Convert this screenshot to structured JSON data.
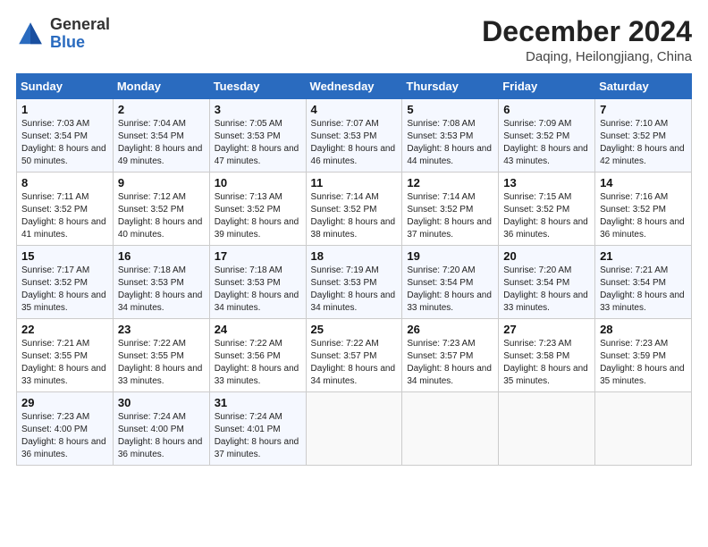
{
  "header": {
    "logo_general": "General",
    "logo_blue": "Blue",
    "month_title": "December 2024",
    "location": "Daqing, Heilongjiang, China"
  },
  "weekdays": [
    "Sunday",
    "Monday",
    "Tuesday",
    "Wednesday",
    "Thursday",
    "Friday",
    "Saturday"
  ],
  "weeks": [
    [
      {
        "day": 1,
        "sunrise": "7:03 AM",
        "sunset": "3:54 PM",
        "daylight": "8 hours and 50 minutes."
      },
      {
        "day": 2,
        "sunrise": "7:04 AM",
        "sunset": "3:54 PM",
        "daylight": "8 hours and 49 minutes."
      },
      {
        "day": 3,
        "sunrise": "7:05 AM",
        "sunset": "3:53 PM",
        "daylight": "8 hours and 47 minutes."
      },
      {
        "day": 4,
        "sunrise": "7:07 AM",
        "sunset": "3:53 PM",
        "daylight": "8 hours and 46 minutes."
      },
      {
        "day": 5,
        "sunrise": "7:08 AM",
        "sunset": "3:53 PM",
        "daylight": "8 hours and 44 minutes."
      },
      {
        "day": 6,
        "sunrise": "7:09 AM",
        "sunset": "3:52 PM",
        "daylight": "8 hours and 43 minutes."
      },
      {
        "day": 7,
        "sunrise": "7:10 AM",
        "sunset": "3:52 PM",
        "daylight": "8 hours and 42 minutes."
      }
    ],
    [
      {
        "day": 8,
        "sunrise": "7:11 AM",
        "sunset": "3:52 PM",
        "daylight": "8 hours and 41 minutes."
      },
      {
        "day": 9,
        "sunrise": "7:12 AM",
        "sunset": "3:52 PM",
        "daylight": "8 hours and 40 minutes."
      },
      {
        "day": 10,
        "sunrise": "7:13 AM",
        "sunset": "3:52 PM",
        "daylight": "8 hours and 39 minutes."
      },
      {
        "day": 11,
        "sunrise": "7:14 AM",
        "sunset": "3:52 PM",
        "daylight": "8 hours and 38 minutes."
      },
      {
        "day": 12,
        "sunrise": "7:14 AM",
        "sunset": "3:52 PM",
        "daylight": "8 hours and 37 minutes."
      },
      {
        "day": 13,
        "sunrise": "7:15 AM",
        "sunset": "3:52 PM",
        "daylight": "8 hours and 36 minutes."
      },
      {
        "day": 14,
        "sunrise": "7:16 AM",
        "sunset": "3:52 PM",
        "daylight": "8 hours and 36 minutes."
      }
    ],
    [
      {
        "day": 15,
        "sunrise": "7:17 AM",
        "sunset": "3:52 PM",
        "daylight": "8 hours and 35 minutes."
      },
      {
        "day": 16,
        "sunrise": "7:18 AM",
        "sunset": "3:53 PM",
        "daylight": "8 hours and 34 minutes."
      },
      {
        "day": 17,
        "sunrise": "7:18 AM",
        "sunset": "3:53 PM",
        "daylight": "8 hours and 34 minutes."
      },
      {
        "day": 18,
        "sunrise": "7:19 AM",
        "sunset": "3:53 PM",
        "daylight": "8 hours and 34 minutes."
      },
      {
        "day": 19,
        "sunrise": "7:20 AM",
        "sunset": "3:54 PM",
        "daylight": "8 hours and 33 minutes."
      },
      {
        "day": 20,
        "sunrise": "7:20 AM",
        "sunset": "3:54 PM",
        "daylight": "8 hours and 33 minutes."
      },
      {
        "day": 21,
        "sunrise": "7:21 AM",
        "sunset": "3:54 PM",
        "daylight": "8 hours and 33 minutes."
      }
    ],
    [
      {
        "day": 22,
        "sunrise": "7:21 AM",
        "sunset": "3:55 PM",
        "daylight": "8 hours and 33 minutes."
      },
      {
        "day": 23,
        "sunrise": "7:22 AM",
        "sunset": "3:55 PM",
        "daylight": "8 hours and 33 minutes."
      },
      {
        "day": 24,
        "sunrise": "7:22 AM",
        "sunset": "3:56 PM",
        "daylight": "8 hours and 33 minutes."
      },
      {
        "day": 25,
        "sunrise": "7:22 AM",
        "sunset": "3:57 PM",
        "daylight": "8 hours and 34 minutes."
      },
      {
        "day": 26,
        "sunrise": "7:23 AM",
        "sunset": "3:57 PM",
        "daylight": "8 hours and 34 minutes."
      },
      {
        "day": 27,
        "sunrise": "7:23 AM",
        "sunset": "3:58 PM",
        "daylight": "8 hours and 35 minutes."
      },
      {
        "day": 28,
        "sunrise": "7:23 AM",
        "sunset": "3:59 PM",
        "daylight": "8 hours and 35 minutes."
      }
    ],
    [
      {
        "day": 29,
        "sunrise": "7:23 AM",
        "sunset": "4:00 PM",
        "daylight": "8 hours and 36 minutes."
      },
      {
        "day": 30,
        "sunrise": "7:24 AM",
        "sunset": "4:00 PM",
        "daylight": "8 hours and 36 minutes."
      },
      {
        "day": 31,
        "sunrise": "7:24 AM",
        "sunset": "4:01 PM",
        "daylight": "8 hours and 37 minutes."
      },
      null,
      null,
      null,
      null
    ]
  ]
}
